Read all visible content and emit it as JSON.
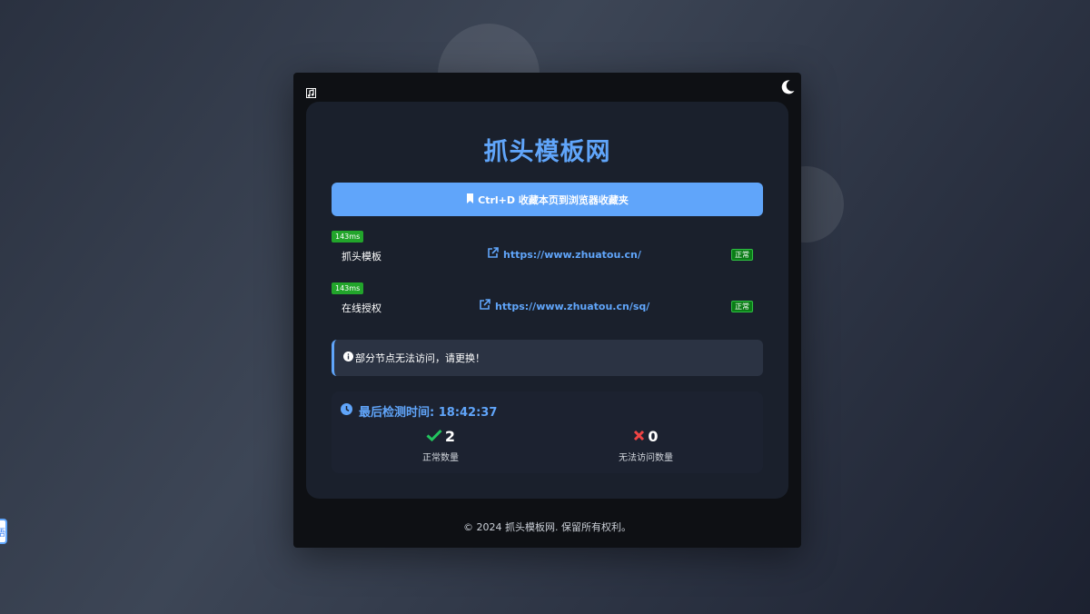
{
  "side_tab": {
    "label": "语"
  },
  "header": {
    "title": "抓头模板网"
  },
  "bookmark": {
    "label": "Ctrl+D 收藏本页到浏览器收藏夹"
  },
  "sites": [
    {
      "latency": "143ms",
      "name": "抓头模板",
      "url": "https://www.zhuatou.cn/",
      "status": "正常"
    },
    {
      "latency": "143ms",
      "name": "在线授权",
      "url": "https://www.zhuatou.cn/sq/",
      "status": "正常"
    }
  ],
  "notice": {
    "text": "部分节点无法访问，请更换！"
  },
  "stats": {
    "check_time_label": "最后检测时间: 18:42:37",
    "normal_count": "2",
    "normal_label": "正常数量",
    "failed_count": "0",
    "failed_label": "无法访问数量"
  },
  "footer": {
    "text": "© 2024 抓头模板网. 保留所有权利。"
  },
  "colors": {
    "accent": "#60a5fa",
    "latency_green": "#22a52b",
    "status_green": "#0a7c16",
    "check_green": "#22c55e",
    "error_red": "#ef4444"
  },
  "icons": {
    "corner": "music-note-icon",
    "theme": "moon-icon",
    "bookmark": "bookmark-icon",
    "link": "external-link-icon",
    "info": "info-circle-icon",
    "clock": "clock-icon",
    "ok": "check-icon",
    "fail": "x-icon"
  }
}
